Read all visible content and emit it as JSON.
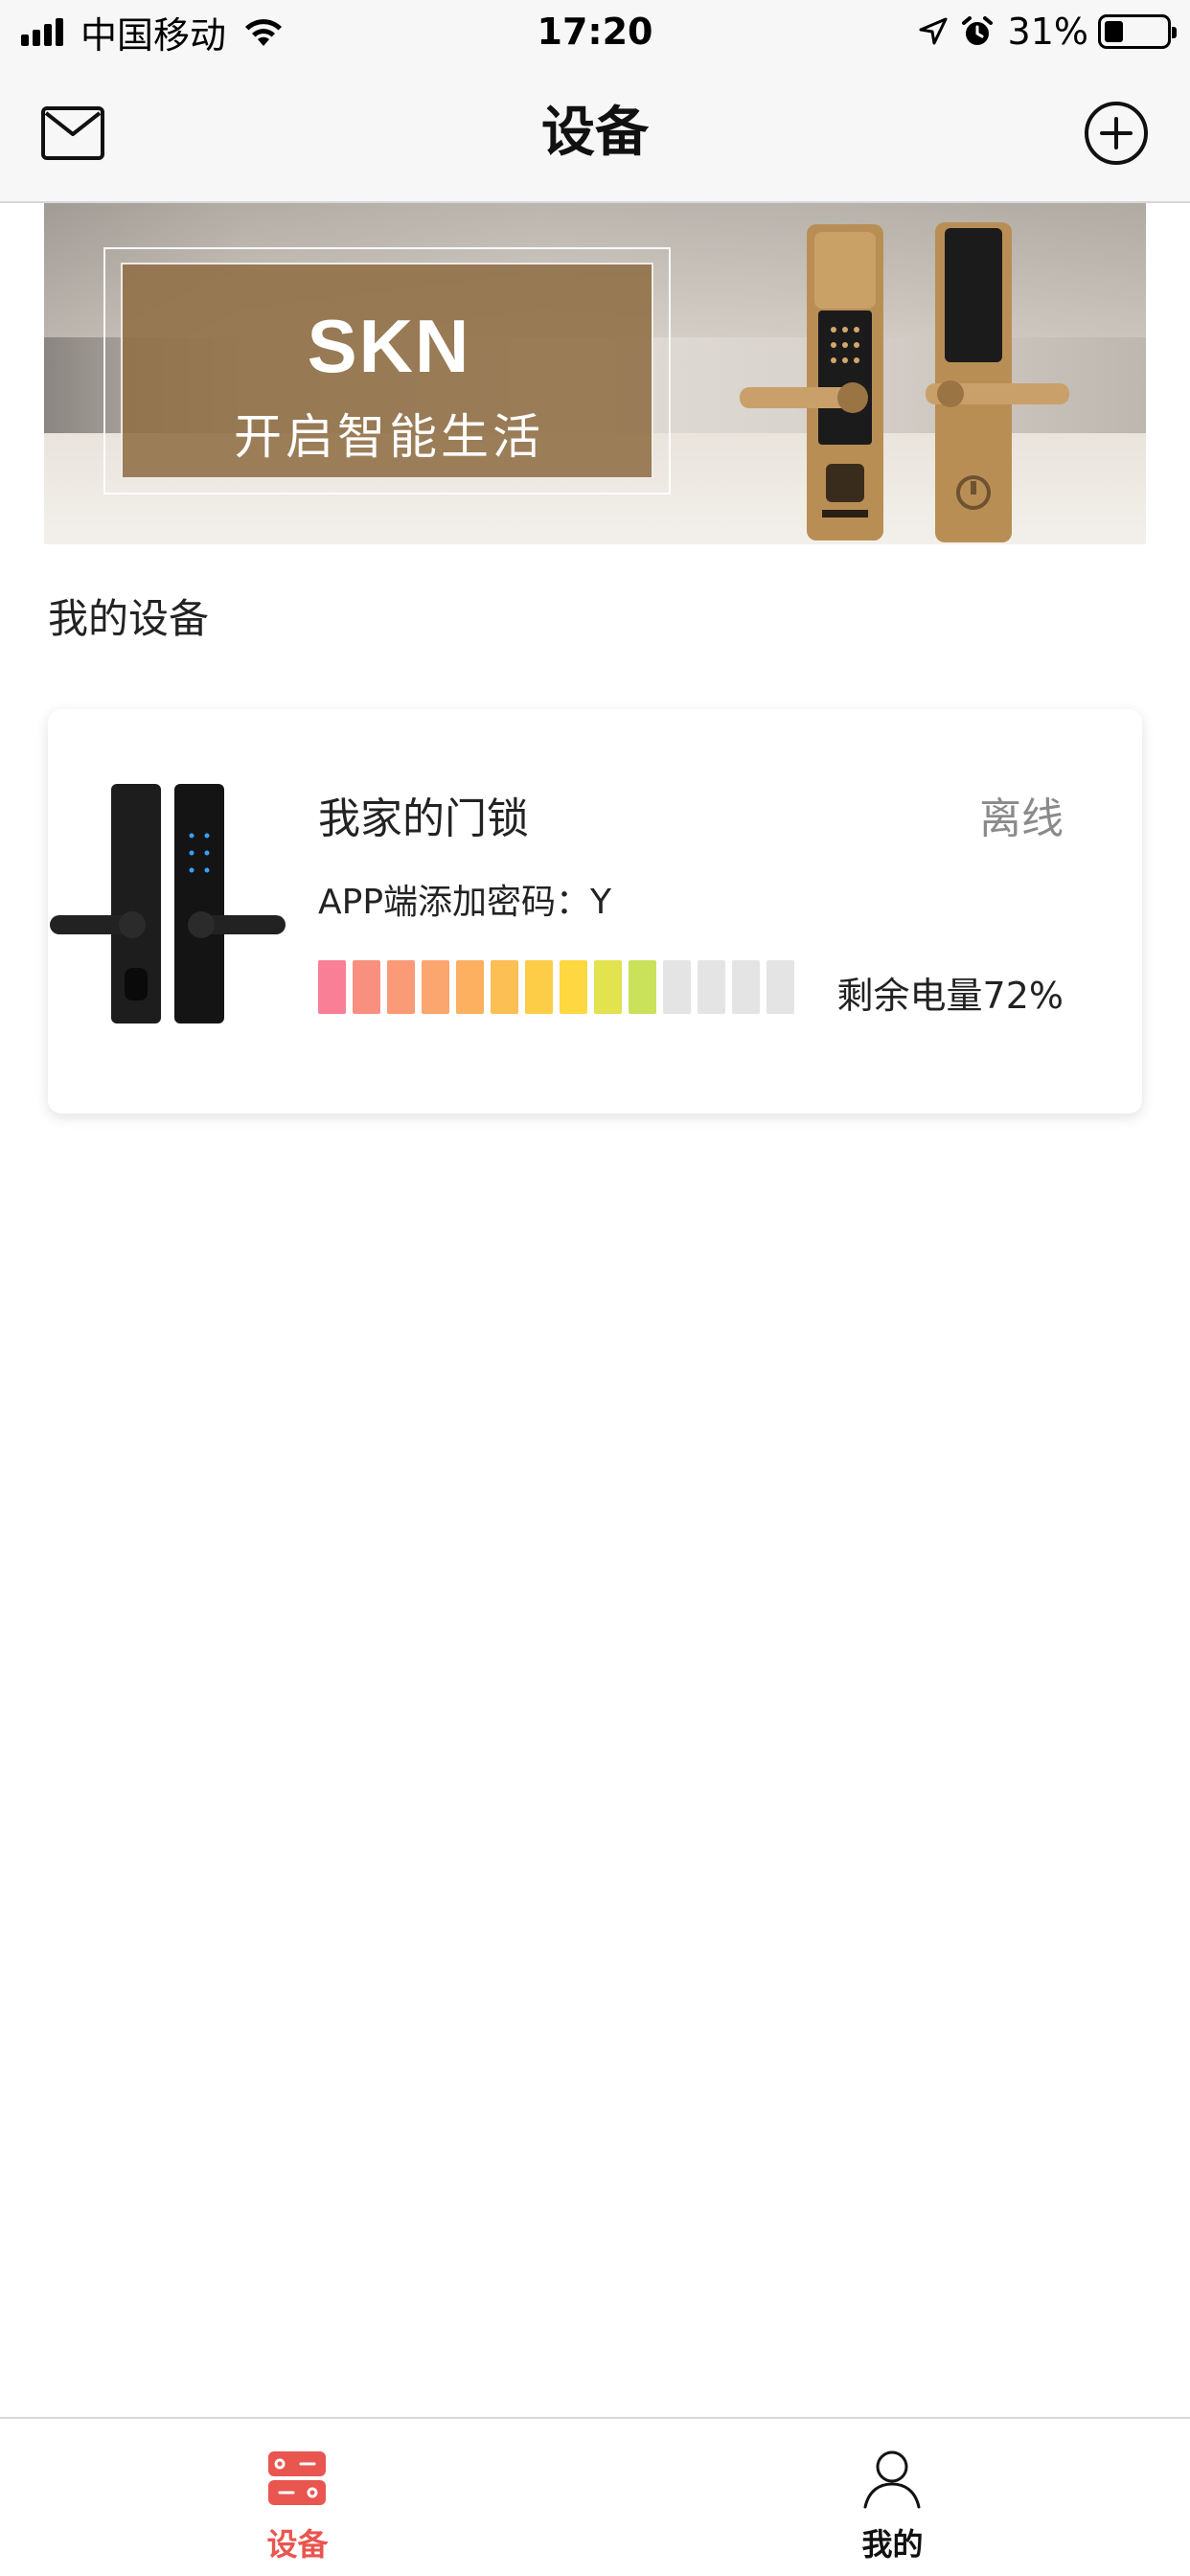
{
  "status_bar": {
    "carrier": "中国移动",
    "time": "17:20",
    "battery_percent": "31%",
    "battery_level": 0.31,
    "icons": [
      "signal-icon",
      "wifi-icon",
      "location-arrow-icon",
      "alarm-icon",
      "battery-icon"
    ]
  },
  "nav": {
    "title": "设备",
    "left_icon": "mail-icon",
    "right_icon": "add-circle-icon"
  },
  "banner": {
    "logo": "SKN",
    "slogan": "开启智能生活"
  },
  "section": {
    "title": "我的设备"
  },
  "device": {
    "name": "我家的门锁",
    "status": "离线",
    "password_text": "APP端添加密码：Y",
    "battery_label": "剩余电量72%",
    "battery_level_percent": 72,
    "battery_segments_total": 14,
    "battery_segments_filled": 10,
    "battery_colors": [
      "#f87f95",
      "#f9907f",
      "#fa9a77",
      "#fba56f",
      "#fcb060",
      "#fcbf53",
      "#fdcd48",
      "#fdd840",
      "#e3e24f",
      "#c9e25a"
    ],
    "battery_empty_color": "#e4e4e4"
  },
  "tabs": [
    {
      "label": "设备",
      "icon": "devices-icon",
      "active": true,
      "color": "#e9554f"
    },
    {
      "label": "我的",
      "icon": "user-icon",
      "active": false,
      "color": "#111111"
    }
  ]
}
